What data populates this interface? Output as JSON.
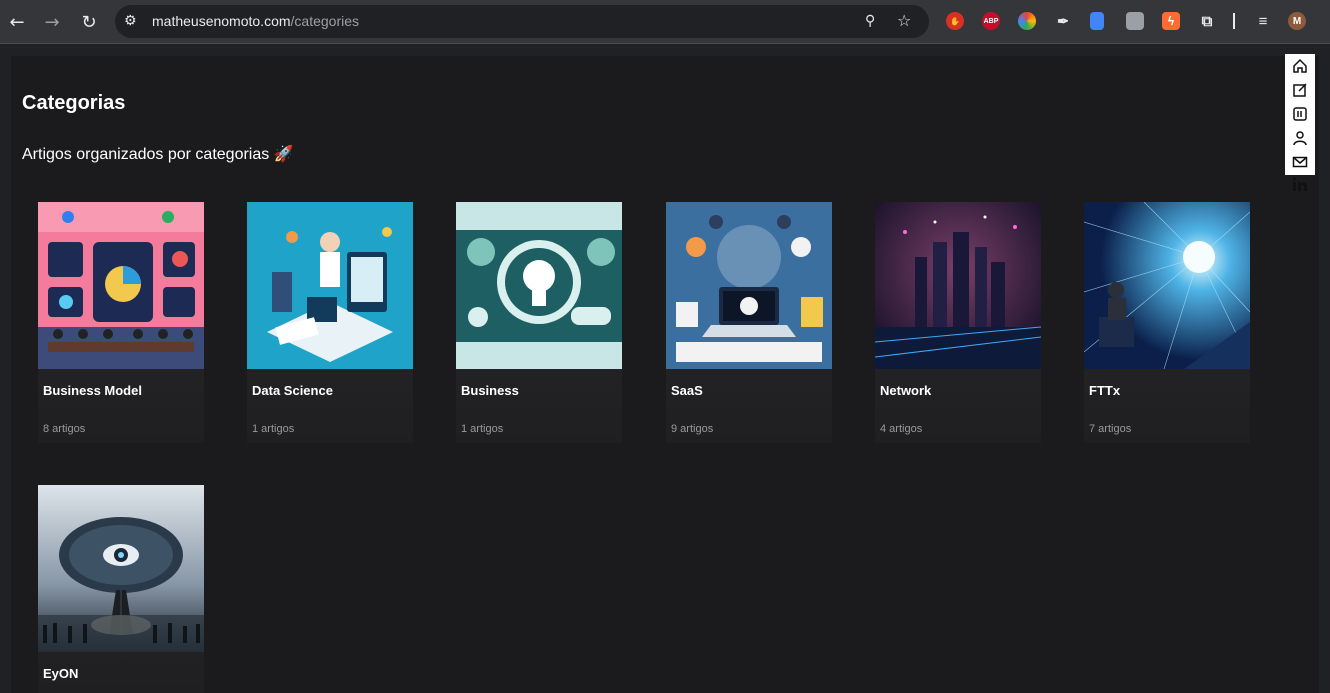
{
  "browser": {
    "url_domain": "matheusenomoto.com",
    "url_path": "/categories",
    "nav_back_glyph": "←",
    "nav_forward_glyph": "→",
    "nav_reload_glyph": "↻",
    "site_info_glyph": "⚙",
    "zoom_glyph": "⚲",
    "star_glyph": "☆",
    "extensions": [
      {
        "name": "stop-extension-icon",
        "label": "✋",
        "color": "#d93025"
      },
      {
        "name": "adblock-plus-icon",
        "label": "ABP",
        "color": "#c70d2c"
      },
      {
        "name": "color-wheel-icon",
        "label": "◉",
        "color": "#6c5ce7"
      },
      {
        "name": "color-picker-icon",
        "label": "✒",
        "color": "#35363a"
      },
      {
        "name": "docs-extension-icon",
        "label": "▮",
        "color": "#4285f4"
      },
      {
        "name": "printer-extension-icon",
        "label": "▤",
        "color": "#9aa0a6"
      },
      {
        "name": "bolt-extension-icon",
        "label": "ϟ",
        "color": "#ff6b35"
      },
      {
        "name": "puzzle-icon",
        "label": "⧉",
        "color": "#35363a"
      }
    ],
    "media_glyph": "≡",
    "profile_initial": "M"
  },
  "page": {
    "title": "Categorias",
    "subtitle": "Artigos organizados por categorias 🚀"
  },
  "categories": [
    {
      "title": "Business Model",
      "count": "8 artigos"
    },
    {
      "title": "Data Science",
      "count": "1 artigos"
    },
    {
      "title": "Business",
      "count": "1 artigos"
    },
    {
      "title": "SaaS",
      "count": "9 artigos"
    },
    {
      "title": "Network",
      "count": "4 artigos"
    },
    {
      "title": "FTTx",
      "count": "7 artigos"
    },
    {
      "title": "EyON",
      "count": ""
    }
  ],
  "sidenav": [
    "home-icon",
    "edit-icon",
    "library-icon",
    "user-icon",
    "mail-icon",
    "linkedin-icon"
  ]
}
